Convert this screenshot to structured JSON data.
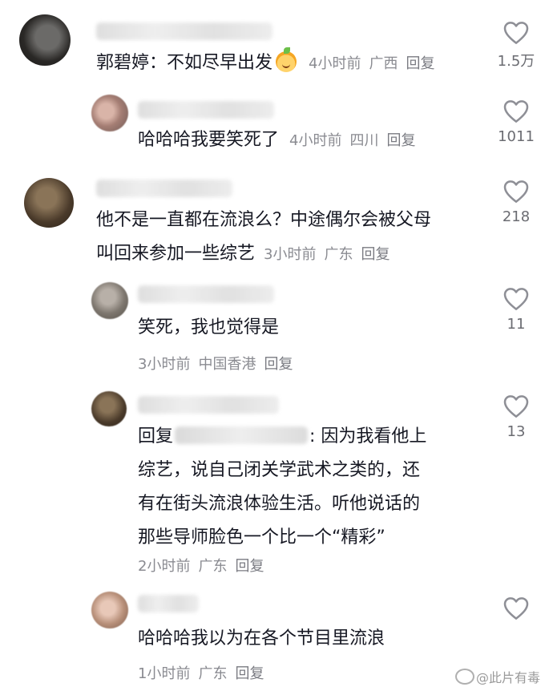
{
  "comments": [
    {
      "text": "郭碧婷：不如尽早出发",
      "emoji": "smiling-fruit-emoji",
      "time": "4小时前",
      "location": "广西",
      "reply": "回复",
      "likes": "1.5万"
    },
    {
      "text": "哈哈哈我要笑死了",
      "time": "4小时前",
      "location": "四川",
      "reply": "回复",
      "likes": "1011"
    },
    {
      "line1": "他不是一直都在流浪么？中途偶尔会被父母",
      "line2": "叫回来参加一些综艺",
      "time": "3小时前",
      "location": "广东",
      "reply": "回复",
      "likes": "218"
    },
    {
      "text": "笑死，我也觉得是",
      "time": "3小时前",
      "location": "中国香港",
      "reply": "回复",
      "likes": "11"
    },
    {
      "reply_prefix": "回复",
      "line1_tail": ": 因为我看他上",
      "line2": "综艺，说自己闭关学武术之类的，还",
      "line3": "有在街头流浪体验生活。听他说话的",
      "line4": "那些导师脸色一个比一个“精彩”",
      "time": "2小时前",
      "location": "广东",
      "reply": "回复",
      "likes": "13"
    },
    {
      "text": "哈哈哈我以为在各个节目里流浪",
      "time": "1小时前",
      "location": "广东",
      "reply": "回复"
    }
  ],
  "watermark": "@此片有毒",
  "colors": {
    "text": "#161823",
    "meta": "#8a8b91",
    "icon": "#8e8f96"
  }
}
